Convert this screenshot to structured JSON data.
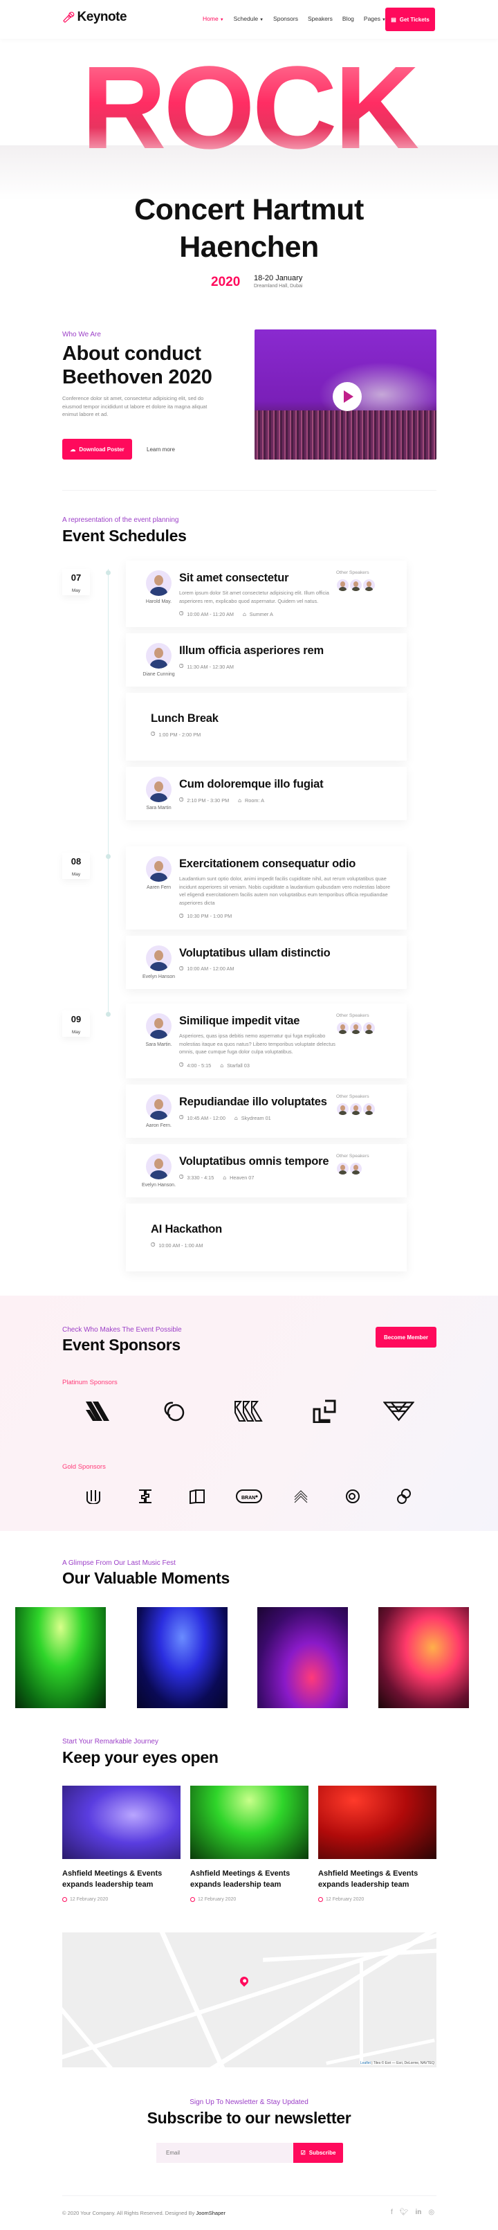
{
  "nav": {
    "logo": "Keynote",
    "items": [
      {
        "label": "Home",
        "caret": true,
        "active": true
      },
      {
        "label": "Schedule",
        "caret": true
      },
      {
        "label": "Sponsors"
      },
      {
        "label": "Speakers"
      },
      {
        "label": "Blog"
      },
      {
        "label": "Pages",
        "caret": true
      }
    ],
    "cta": "Get Tickets"
  },
  "hero": {
    "big_word": "ROCK",
    "title_line1": "Concert Hartmut",
    "title_line2": "Haenchen",
    "year": "2020",
    "date": "18-20 January",
    "venue": "Dreamland Hall, Dubai"
  },
  "about": {
    "subtitle": "Who We Are",
    "title_line1": "About conduct",
    "title_line2": "Beethoven 2020",
    "text": "Conference dolor sit amet, consectetur adipisicing elit, sed do eiusmod tempor incididunt ut labore et dolore ita magna aliquat enimut labore et ad.",
    "download": "Download Poster",
    "learn": "Learn more"
  },
  "schedule": {
    "subtitle": "A representation of the event planning",
    "title": "Event Schedules",
    "other_label": "Other Speakers",
    "days": [
      {
        "day": "07",
        "month": "May",
        "items": [
          {
            "speaker": "Harold May.",
            "title": "Sit amet consectetur",
            "desc": "Lorem ipsum dolor Sit amet consectetur adipisicing elit. Illum officia asperiores rem, explicabo quod aspernatur. Quidem vel natus.",
            "time": "10:00 AM - 11:20 AM",
            "room": "Summer A",
            "others": 3
          },
          {
            "speaker": "Diane Cunning",
            "title": "Illum officia asperiores rem",
            "time": "11:30 AM - 12:30 AM"
          },
          {
            "title": "Lunch Break",
            "time": "1:00 PM - 2:00 PM",
            "break": true
          },
          {
            "speaker": "Sara Martin",
            "title": "Cum doloremque illo fugiat",
            "time": "2:10 PM - 3:30 PM",
            "room": "Room: A"
          }
        ]
      },
      {
        "day": "08",
        "month": "May",
        "items": [
          {
            "speaker": "Aaren Fern",
            "title": "Exercitationem consequatur odio",
            "desc": "Laudantium sunt optio dolor, animi impedit facilis cupiditate nihil, aut rerum voluptatibus quae incidunt asperiores sit veniam. Nobis cupiditate a laudantium quibusdam vero molestias labore vel eligendi exercitationem facilis autem non voluptatibus eum temporibus officia repudiandae asperiores dicta",
            "time": "10:30 PM - 1:00 PM"
          },
          {
            "speaker": "Evelyn Hanson",
            "title": "Voluptatibus ullam distinctio",
            "time": "10:00 AM - 12:00 AM"
          }
        ]
      },
      {
        "day": "09",
        "month": "May",
        "items": [
          {
            "speaker": "Sara Martin.",
            "title": "Similique impedit vitae",
            "desc": "Asperiores, quas ipsa debitis nemo aspernatur qui fuga explicabo molestias itaque ea quos natus? Libero temporibus voluptate delectus omnis, quae cumque fuga dolor culpa voluptatibus.",
            "time": "4:00 - 5:15",
            "room": "Starfall 03",
            "others": 3
          },
          {
            "speaker": "Aaron Fern.",
            "title": "Repudiandae illo voluptates",
            "time": "10:45 AM - 12:00",
            "room": "Skydream 01",
            "others": 3
          },
          {
            "speaker": "Evelyn Hanson.",
            "title": "Voluptatibus omnis tempore",
            "time": "3:330 - 4:15",
            "room": "Heaven 07",
            "others": 2
          },
          {
            "title": "AI Hackathon",
            "time": "10:00 AM - 1:00 AM",
            "break": true
          }
        ]
      }
    ]
  },
  "sponsors": {
    "subtitle": "Check Who Makes The Event Possible",
    "title": "Event Sponsors",
    "cta": "Become Member",
    "platinum_label": "Platinum Sponsors",
    "gold_label": "Gold Sponsors",
    "gold_brand_text": "BRAN"
  },
  "moments": {
    "subtitle": "A Glimpse From Our Last Music Fest",
    "title": "Our Valuable Moments"
  },
  "blog": {
    "subtitle": "Start Your Remarkable Journey",
    "title": "Keep your eyes open",
    "posts": [
      {
        "title": "Ashfield Meetings & Events expands leadership team",
        "date": "12 February 2020"
      },
      {
        "title": "Ashfield Meetings & Events expands leadership team",
        "date": "12 February 2020"
      },
      {
        "title": "Ashfield Meetings & Events expands leadership team",
        "date": "12 February 2020"
      }
    ]
  },
  "map": {
    "attribution_link": "Leaflet",
    "attribution": " | Tiles © Esri — Esri, DeLorme, NAVTEQ"
  },
  "newsletter": {
    "subtitle": "Sign Up To Newsletter & Stay Updated",
    "title": "Subscribe to our newsletter",
    "placeholder": "Email",
    "button": "Subscribe"
  },
  "footer": {
    "copyright": "© 2020 Your Company. All Rights Reserved. Designed By ",
    "designer": "JoomShaper",
    "social": [
      "facebook",
      "twitter",
      "linkedin",
      "instagram"
    ]
  },
  "colors": {
    "accent": "#ff0a5c",
    "subtitle": "#9b3fc7"
  }
}
